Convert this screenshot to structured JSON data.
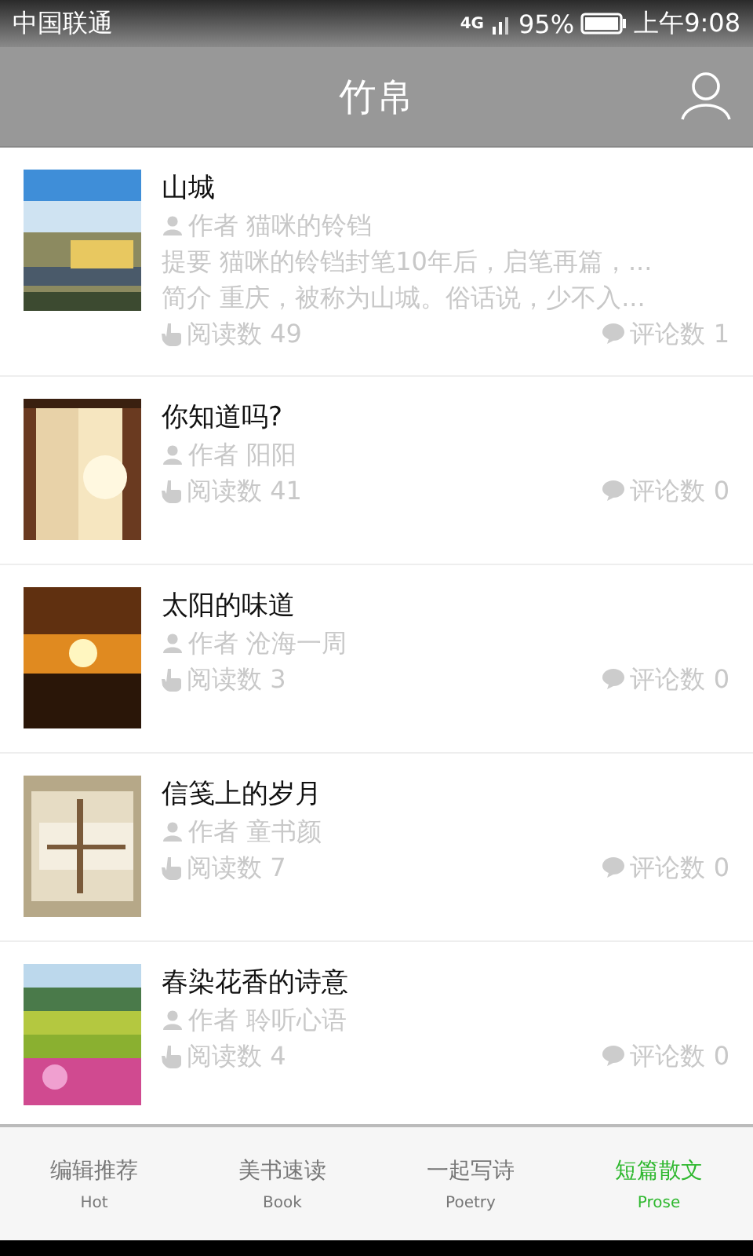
{
  "status_bar": {
    "carrier": "中国联通",
    "network": "4G",
    "battery": "95%",
    "time": "上午9:08"
  },
  "header": {
    "title": "竹帛"
  },
  "articles": [
    {
      "title": "山城",
      "author": "作者 猫咪的铃铛",
      "summary": "提要 猫咪的铃铛封笔10年后，启笔再篇，...",
      "intro": "简介 重庆，被称为山城。俗话说，少不入...",
      "reads": "阅读数 49",
      "comments": "评论数 1"
    },
    {
      "title": "你知道吗?",
      "author": "作者 阳阳",
      "reads": "阅读数 41",
      "comments": "评论数 0"
    },
    {
      "title": "太阳的味道",
      "author": "作者 沧海一周",
      "reads": "阅读数 3",
      "comments": "评论数 0"
    },
    {
      "title": "信笺上的岁月",
      "author": "作者 童书颜",
      "reads": "阅读数 7",
      "comments": "评论数 0"
    },
    {
      "title": "春染花香的诗意",
      "author": "作者 聆听心语",
      "reads": "阅读数 4",
      "comments": "评论数 0"
    }
  ],
  "tabs": [
    {
      "label": "编辑推荐",
      "sublabel": "Hot",
      "selected": false
    },
    {
      "label": "美书速读",
      "sublabel": "Book",
      "selected": false
    },
    {
      "label": "一起写诗",
      "sublabel": "Poetry",
      "selected": false
    },
    {
      "label": "短篇散文",
      "sublabel": "Prose",
      "selected": true
    }
  ]
}
